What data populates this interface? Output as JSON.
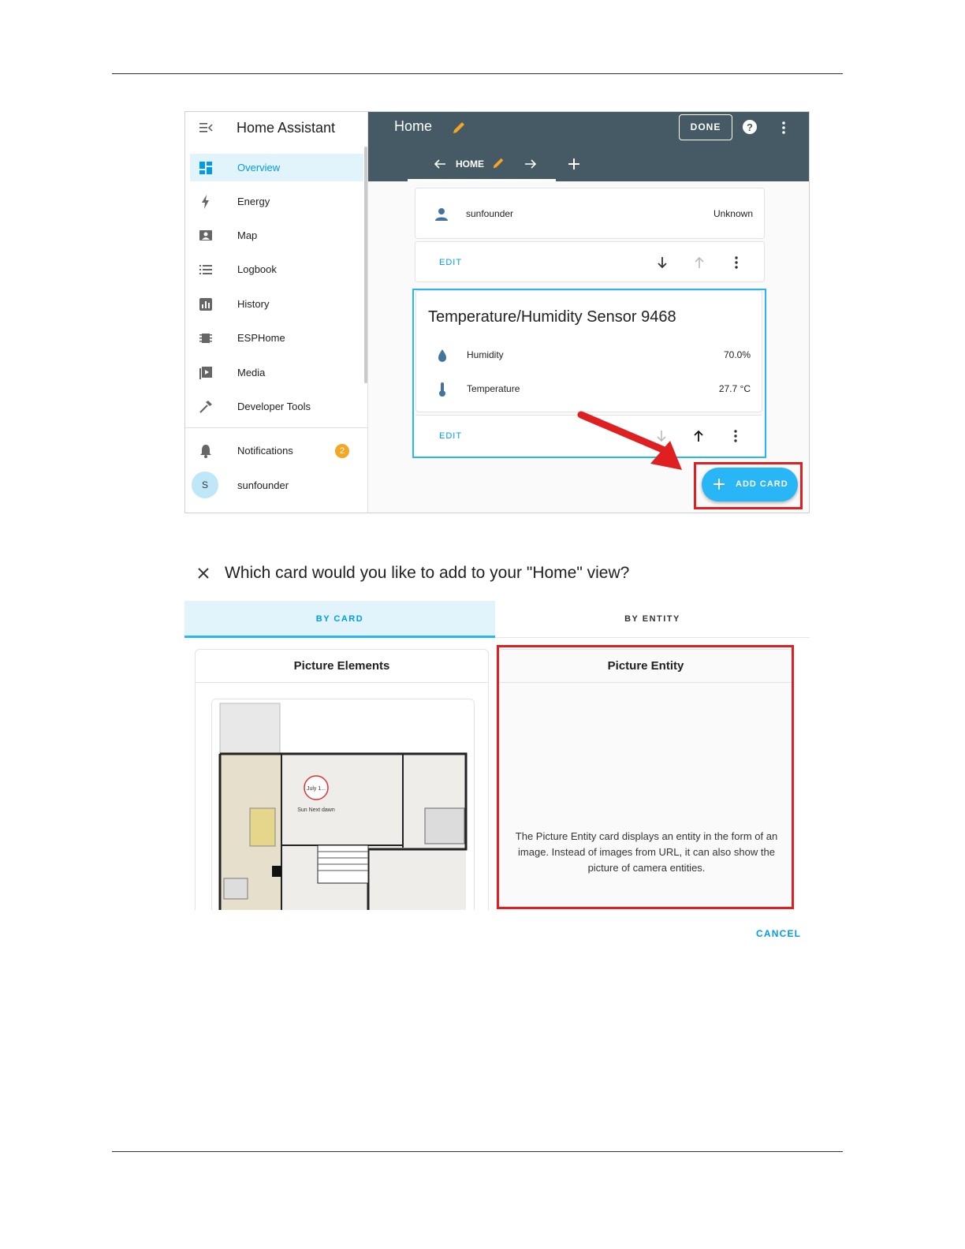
{
  "screenshot1": {
    "sidebar": {
      "title": "Home Assistant",
      "items": [
        {
          "label": "Overview",
          "icon": "overview-icon",
          "active": true
        },
        {
          "label": "Energy",
          "icon": "bolt-icon"
        },
        {
          "label": "Map",
          "icon": "map-icon"
        },
        {
          "label": "Logbook",
          "icon": "logbook-icon"
        },
        {
          "label": "History",
          "icon": "history-chart-icon"
        },
        {
          "label": "ESPHome",
          "icon": "chip-icon"
        },
        {
          "label": "Media",
          "icon": "media-play-icon"
        },
        {
          "label": "Developer Tools",
          "icon": "hammer-icon"
        }
      ],
      "notifications": {
        "label": "Notifications",
        "count": "2"
      },
      "user": {
        "label": "sunfounder",
        "initial": "S"
      }
    },
    "header": {
      "title": "Home",
      "done_label": "DONE",
      "tab_label": "HOME"
    },
    "person_card": {
      "name": "sunfounder",
      "state": "Unknown",
      "edit_label": "EDIT"
    },
    "sensor_card": {
      "title": "Temperature/Humidity Sensor 9468",
      "rows": [
        {
          "label": "Humidity",
          "value": "70.0%",
          "icon": "water-percent-icon"
        },
        {
          "label": "Temperature",
          "value": "27.7 °C",
          "icon": "thermometer-icon"
        }
      ],
      "edit_label": "EDIT"
    },
    "add_card_label": "ADD CARD",
    "colors": {
      "header": "#455a64",
      "accent": "#29b6f6",
      "highlight": "#e02020",
      "badge": "#f5a623"
    }
  },
  "screenshot2": {
    "dialog_title": "Which card would you like to add to your \"Home\" view?",
    "tabs": [
      "BY CARD",
      "BY ENTITY"
    ],
    "cards": [
      {
        "title": "Picture Elements",
        "floorplan_text": "July 1...",
        "floorplan_subtext": "Sun Next dawn"
      },
      {
        "title": "Picture Entity",
        "description": "The Picture Entity card displays an entity in the form of an image. Instead of images from URL, it can also show the picture of camera entities."
      }
    ],
    "cancel_label": "CANCEL"
  }
}
